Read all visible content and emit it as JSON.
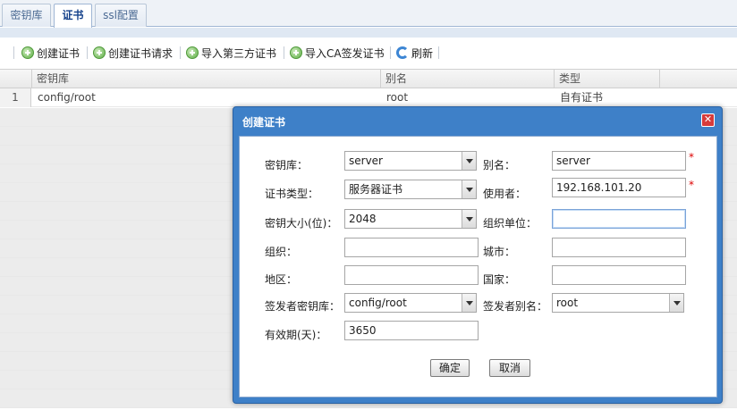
{
  "tabs": [
    {
      "label": "密钥库",
      "active": false
    },
    {
      "label": "证书",
      "active": true
    },
    {
      "label": "ssl配置",
      "active": false
    }
  ],
  "toolbar": {
    "create_cert": "创建证书",
    "create_cert_request": "创建证书请求",
    "import_third_party": "导入第三方证书",
    "import_ca_signed": "导入CA签发证书",
    "refresh": "刷新"
  },
  "grid": {
    "columns": [
      "密钥库",
      "别名",
      "类型"
    ],
    "rows": [
      {
        "num": "1",
        "keystore": "config/root",
        "alias": "root",
        "type": "自有证书"
      }
    ]
  },
  "dialog": {
    "title": "创建证书",
    "close": "✕",
    "labels": {
      "keystore": "密钥库：",
      "alias": "别名：",
      "cert_type": "证书类型：",
      "user": "使用者：",
      "key_size": "密钥大小(位)：",
      "org_unit": "组织单位：",
      "org": "组织：",
      "city": "城市：",
      "region": "地区：",
      "country": "国家：",
      "issuer_keystore": "签发者密钥库：",
      "issuer_alias": "签发者别名：",
      "validity": "有效期(天)："
    },
    "values": {
      "keystore": "server",
      "alias": "server",
      "cert_type": "服务器证书",
      "user": "192.168.101.20",
      "key_size": "2048",
      "org_unit": "",
      "org": "",
      "city": "",
      "region": "",
      "country": "",
      "issuer_keystore": "config/root",
      "issuer_alias": "root",
      "validity": "3650"
    },
    "required_mark": "*",
    "ok": "确定",
    "cancel": "取消"
  }
}
